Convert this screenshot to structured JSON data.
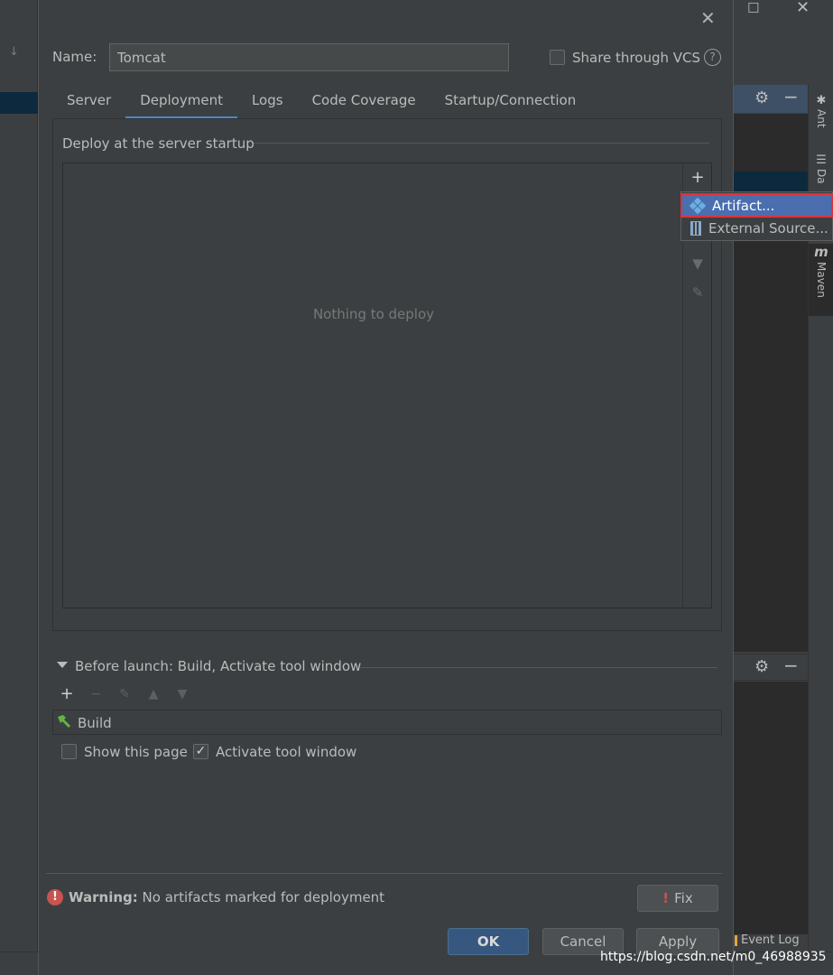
{
  "dialog": {
    "name_label": "Name:",
    "name_value": "Tomcat",
    "share_label": "Share through VCS",
    "share_checked": false,
    "help_glyph": "?",
    "close_glyph": "✕",
    "tabs": [
      {
        "label": "Server",
        "active": false
      },
      {
        "label": "Deployment",
        "active": true
      },
      {
        "label": "Logs",
        "active": false
      },
      {
        "label": "Code Coverage",
        "active": false
      },
      {
        "label": "Startup/Connection",
        "active": false
      }
    ],
    "deploy_group_title": "Deploy at the server startup",
    "empty_text": "Nothing to deploy",
    "before_launch_title": "Before launch: Build, Activate tool window",
    "before_launch_items": [
      {
        "label": "Build",
        "icon": "hammer-icon"
      }
    ],
    "show_page_label": "Show this page",
    "show_page_checked": false,
    "activate_label": "Activate tool window",
    "activate_checked": true,
    "warning_bold": "Warning:",
    "warning_text": "No artifacts marked for deployment",
    "fix_label": "Fix",
    "ok_label": "OK",
    "cancel_label": "Cancel",
    "apply_label": "Apply"
  },
  "popup": {
    "items": [
      {
        "label": "Artifact...",
        "icon": "artifact-icon",
        "selected": true
      },
      {
        "label": "External Source...",
        "icon": "external-source-icon",
        "selected": false
      }
    ]
  },
  "side_tabs": [
    "Ant",
    "Da",
    "Maven"
  ],
  "maven_glyph": "m",
  "event_log": "Event Log",
  "watermark": "https://blog.csdn.net/m0_46988935",
  "colors": {
    "dialog_bg": "#3c3f41",
    "accent": "#4a88c7",
    "selection": "#4b6eaf",
    "highlight_box": "#e0303a",
    "error": "#c75450",
    "ok_button": "#365880"
  }
}
